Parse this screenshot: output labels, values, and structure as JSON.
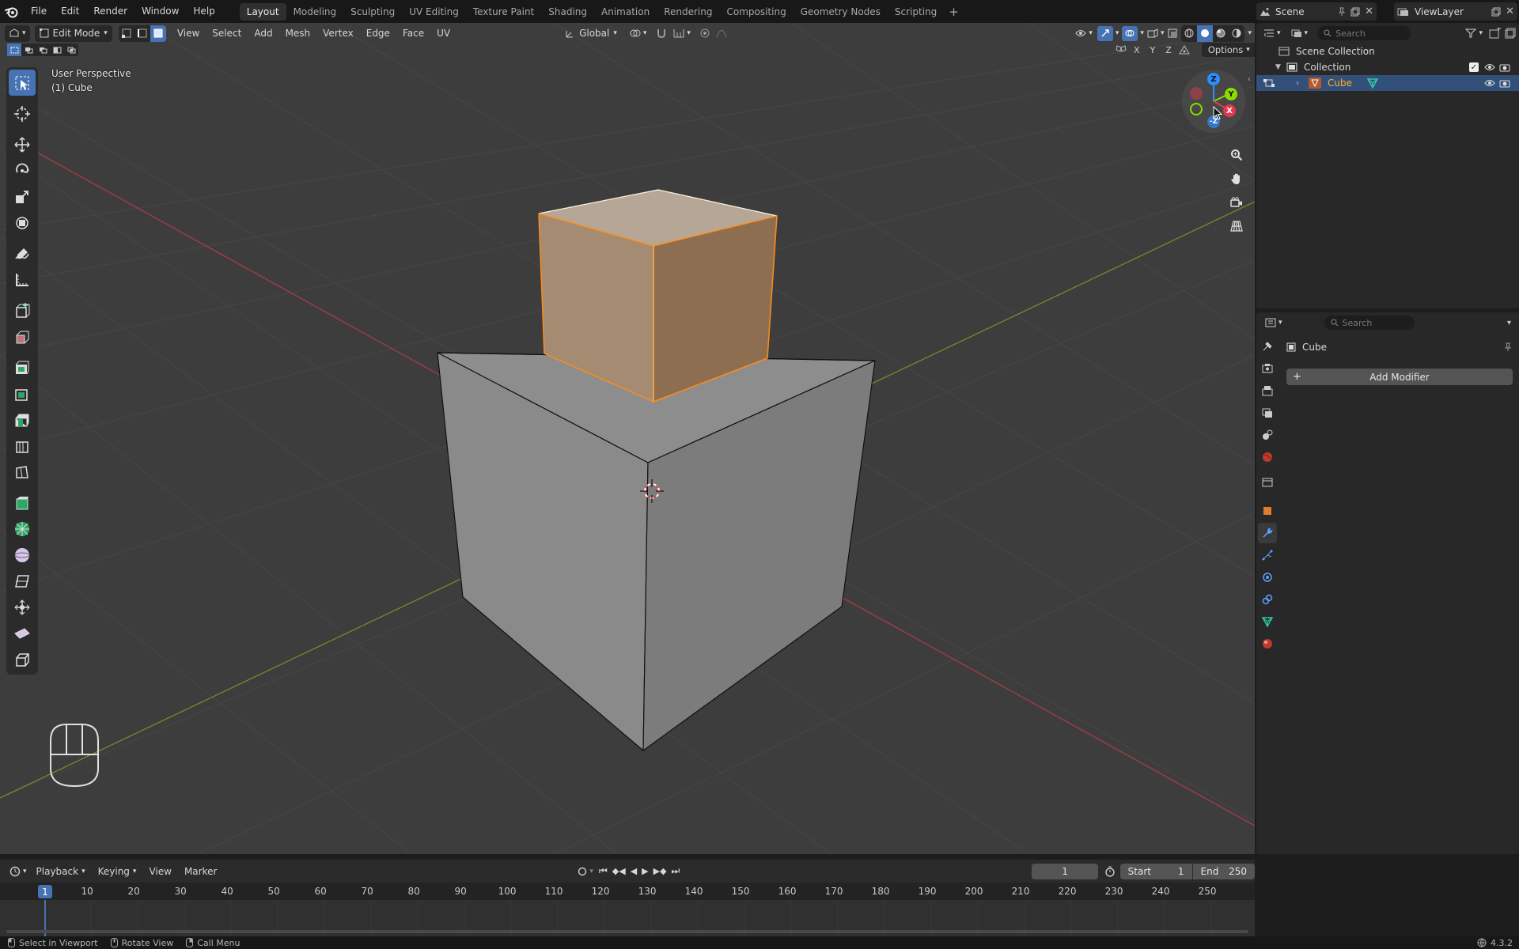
{
  "topbar": {
    "menus": [
      "File",
      "Edit",
      "Render",
      "Window",
      "Help"
    ],
    "workspaces": [
      "Layout",
      "Modeling",
      "Sculpting",
      "UV Editing",
      "Texture Paint",
      "Shading",
      "Animation",
      "Rendering",
      "Compositing",
      "Geometry Nodes",
      "Scripting"
    ],
    "active_workspace": "Layout",
    "add_workspace": "+",
    "scene": "Scene",
    "view_layer": "ViewLayer"
  },
  "viewport": {
    "mode": "Edit Mode",
    "menus": [
      "View",
      "Select",
      "Add",
      "Mesh",
      "Vertex",
      "Edge",
      "Face",
      "UV"
    ],
    "transform_orientation": "Global",
    "options_label": "Options",
    "axis_labels": [
      "X",
      "Y",
      "Z"
    ],
    "view_name": "User Perspective",
    "object_info": "(1) Cube",
    "gizmo": {
      "z": "Z",
      "y": "Y",
      "x": "X",
      "neg_z": "-Z"
    }
  },
  "outliner": {
    "search_placeholder": "Search",
    "scene_collection": "Scene Collection",
    "collection": "Collection",
    "object": "Cube"
  },
  "properties": {
    "search_placeholder": "Search",
    "object_name": "Cube",
    "add_modifier": "Add Modifier"
  },
  "timeline": {
    "menus": [
      "Playback",
      "Keying",
      "View",
      "Marker"
    ],
    "current_frame": "1",
    "start_label": "Start",
    "start": "1",
    "end_label": "End",
    "end": "250",
    "ticks": [
      "1",
      "10",
      "20",
      "30",
      "40",
      "50",
      "60",
      "70",
      "80",
      "90",
      "100",
      "110",
      "120",
      "130",
      "140",
      "150",
      "160",
      "170",
      "180",
      "190",
      "200",
      "210",
      "220",
      "230",
      "240",
      "250"
    ]
  },
  "statusbar": {
    "items": [
      "Select in Viewport",
      "Rotate View",
      "Call Menu"
    ],
    "version": "4.3.2"
  },
  "colors": {
    "accent": "#4772b3",
    "selected_face": "#a48b72",
    "selection_outline": "#ff8c1a",
    "axis_x": "#e5384f",
    "axis_y": "#8bdc00",
    "axis_z": "#2c8fff"
  }
}
